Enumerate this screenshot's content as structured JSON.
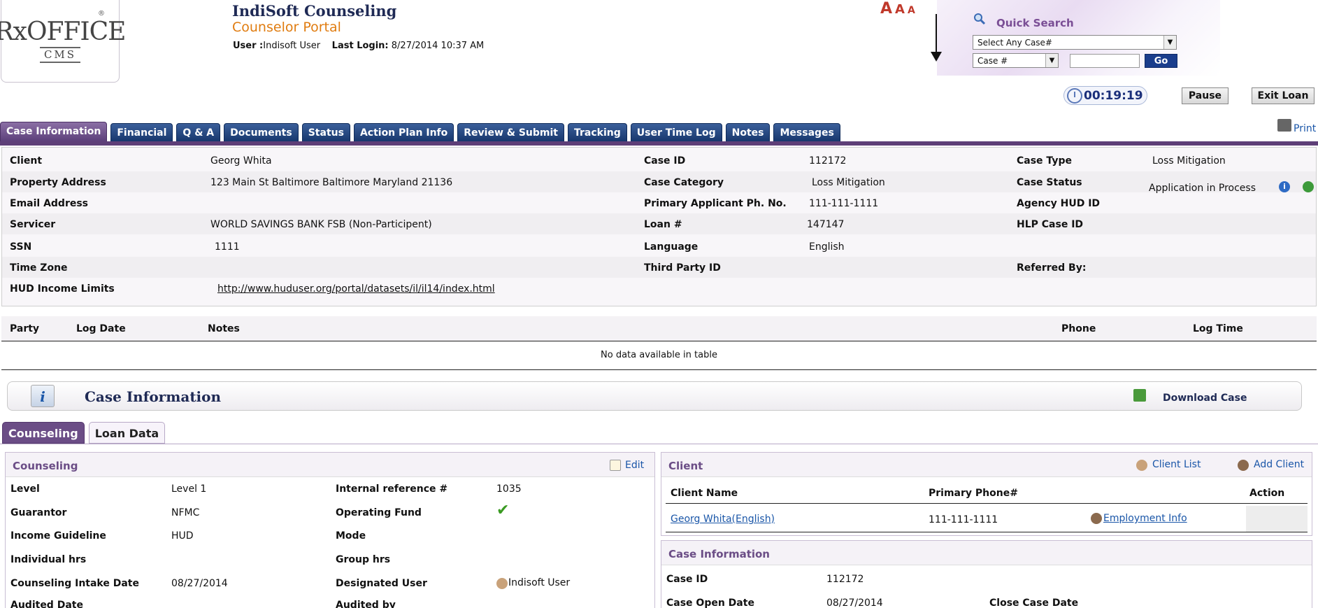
{
  "header": {
    "logo_main": "RxOFFICE",
    "logo_sub": "CMS",
    "logo_reg": "®",
    "org": "IndiSoft Counseling",
    "portal": "Counselor Portal",
    "user_label": "User :",
    "user_value": "Indisoft User",
    "login_label": "Last Login:",
    "login_value": "8/27/2014 10:37 AM",
    "font_sizes": [
      "A",
      "A",
      "A"
    ]
  },
  "quick_search": {
    "title": "Quick Search",
    "case_select": "Select Any Case#",
    "field_select": "Case #",
    "go_label": "Go"
  },
  "session": {
    "timer": "00:19:19",
    "pause_label": "Pause",
    "exit_label": "Exit Loan"
  },
  "tabs": [
    "Case Information",
    "Financial",
    "Q & A",
    "Documents",
    "Status",
    "Action Plan Info",
    "Review & Submit",
    "Tracking",
    "User Time Log",
    "Notes",
    "Messages"
  ],
  "print_label": "Print",
  "case_info": {
    "client_label": "Client",
    "client": "Georg Whita",
    "address_label": "Property Address",
    "address": "123 Main St  Baltimore Baltimore Maryland 21136",
    "email_label": "Email Address",
    "email": "",
    "servicer_label": "Servicer",
    "servicer": "WORLD SAVINGS BANK FSB (Non-Participent)",
    "ssn_label": "SSN",
    "ssn": "1111",
    "tz_label": "Time Zone",
    "tz": "",
    "hud_label": "HUD Income Limits",
    "hud_link": "http://www.huduser.org/portal/datasets/il/il14/index.html",
    "caseid_label": "Case ID",
    "caseid": "112172",
    "category_label": "Case Category",
    "category": "Loss Mitigation",
    "phone_label": "Primary Applicant Ph. No.",
    "phone": "111-111-1111",
    "loan_label": "Loan #",
    "loan": "147147",
    "lang_label": "Language",
    "lang": "English",
    "third_label": "Third Party ID",
    "third": "",
    "type_label": "Case Type",
    "type": "Loss Mitigation",
    "status_label": "Case Status",
    "status": "Application in Process",
    "agency_label": "Agency HUD ID",
    "agency": "",
    "hlp_label": "HLP Case ID",
    "hlp": "",
    "referred_label": "Referred By:",
    "referred": ""
  },
  "log_table": {
    "headers": [
      "Party",
      "Log Date",
      "Notes",
      "Phone",
      "Log Time"
    ],
    "empty_text": "No data available in table"
  },
  "section": {
    "title": "Case Information",
    "download_label": "Download Case"
  },
  "subtabs": [
    "Counseling",
    "Loan Data"
  ],
  "counseling": {
    "title": "Counseling",
    "edit_label": "Edit",
    "level_label": "Level",
    "level": "Level 1",
    "guarantor_label": "Guarantor",
    "guarantor": "NFMC",
    "income_label": "Income Guideline",
    "income": "HUD",
    "indiv_label": "Individual hrs",
    "indiv": "",
    "intake_label": "Counseling Intake Date",
    "intake": "08/27/2014",
    "audited_label": "Audited Date",
    "audited": "",
    "internal_label": "Internal reference #",
    "internal": "1035",
    "fund_label": "Operating Fund",
    "mode_label": "Mode",
    "mode": "",
    "group_label": "Group hrs",
    "group": "",
    "designated_label": "Designated User",
    "designated": "Indisoft User",
    "auditedby_label": "Audited by",
    "auditedby": ""
  },
  "client_panel": {
    "title": "Client",
    "client_list_label": "Client List",
    "add_client_label": "Add Client",
    "headers": [
      "Client Name",
      "Primary Phone#",
      "Action"
    ],
    "row_name": "Georg Whita(English)",
    "row_phone": "111-111-1111",
    "row_link": "Employment Info"
  },
  "case_panel": {
    "title": "Case Information",
    "caseid_label": "Case ID",
    "caseid": "112172",
    "open_label": "Case Open Date",
    "open": "08/27/2014",
    "close_label": "Close Case Date",
    "close": ""
  }
}
